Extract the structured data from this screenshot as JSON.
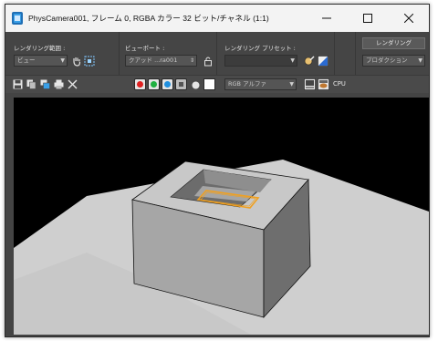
{
  "window": {
    "title": "PhysCamera001, フレーム 0, RGBA カラー 32 ビット/チャネル (1:1)",
    "controls": {
      "minimize": "—",
      "maximize": "☐",
      "close": "✕"
    }
  },
  "render_setup": {
    "area_label": "レンダリング範囲 :",
    "area_value": "ビュー",
    "viewport_label": "ビューポート :",
    "viewport_value": "クアッド ...ra001",
    "preset_label": "レンダリング プリセット :",
    "preset_value": "",
    "render_button": "レンダリング",
    "production_value": "プロダクション"
  },
  "display": {
    "channel_value": "RGB アルファ",
    "cpu_label": "CPU"
  },
  "colors": {
    "accent_orange": "#f0a020",
    "red": "#e02020",
    "green": "#20b040",
    "blue": "#2090e0"
  }
}
